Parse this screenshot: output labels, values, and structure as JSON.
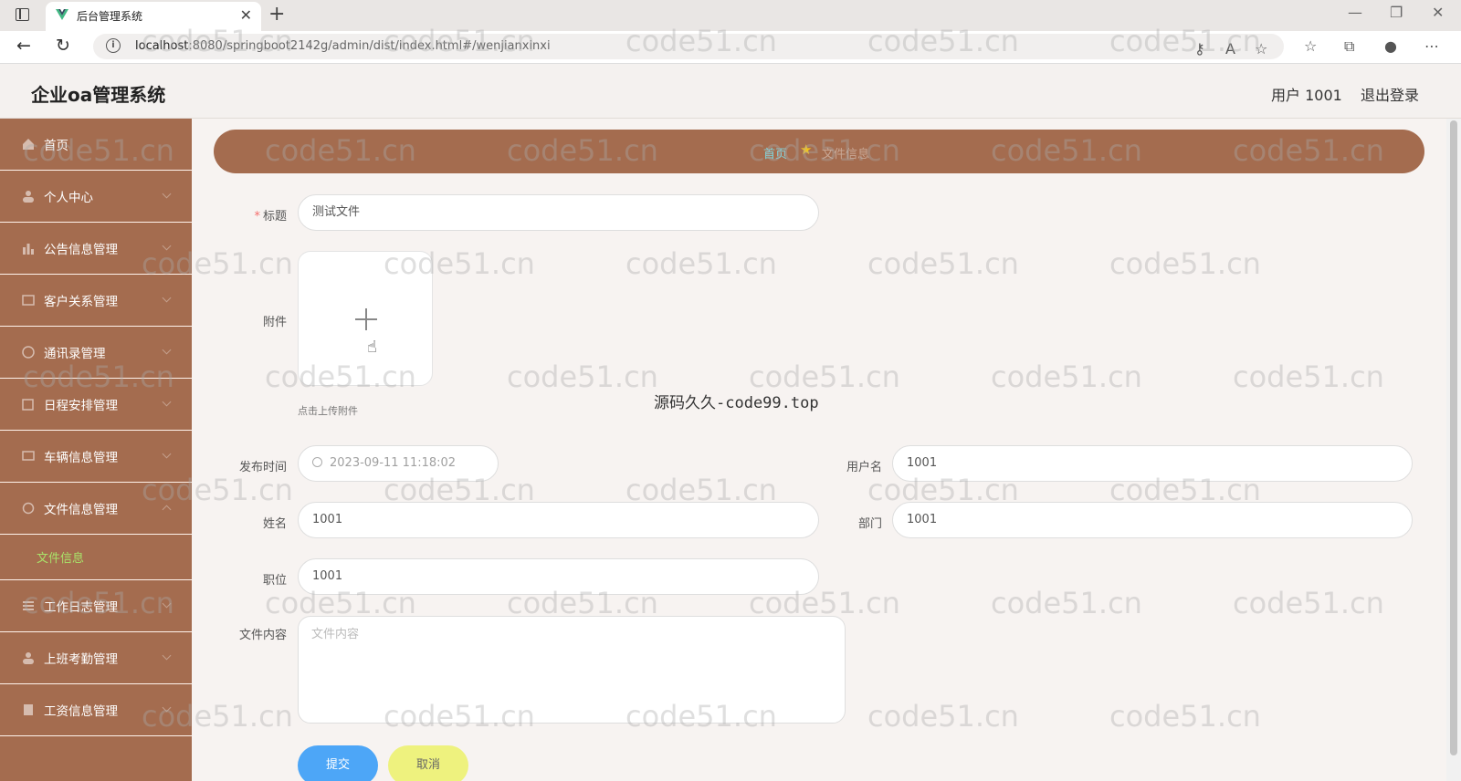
{
  "browser": {
    "tab_title": "后台管理系统",
    "url_host": "localhost",
    "url_rest": ":8080/springboot2142g/admin/dist/index.html#/wenjianxinxi"
  },
  "header": {
    "title": "企业oa管理系统",
    "user": "用户 1001",
    "logout": "退出登录"
  },
  "sidebar": {
    "items": [
      {
        "label": "首页",
        "icon": "home-icon"
      },
      {
        "label": "个人中心",
        "icon": "user-icon"
      },
      {
        "label": "公告信息管理",
        "icon": "chart-icon"
      },
      {
        "label": "客户关系管理",
        "icon": "image-icon"
      },
      {
        "label": "通讯录管理",
        "icon": "compass-icon"
      },
      {
        "label": "日程安排管理",
        "icon": "edit-icon"
      },
      {
        "label": "车辆信息管理",
        "icon": "message-icon"
      },
      {
        "label": "文件信息管理",
        "icon": "refresh-icon"
      },
      {
        "label": "工作日志管理",
        "icon": "menu-icon"
      },
      {
        "label": "上班考勤管理",
        "icon": "user-icon"
      },
      {
        "label": "工资信息管理",
        "icon": "doc-icon"
      }
    ],
    "submenu_active": "文件信息"
  },
  "breadcrumb": {
    "home": "首页",
    "current": "文件信息"
  },
  "form": {
    "title_label": "标题",
    "title_value": "测试文件",
    "attachment_label": "附件",
    "upload_tip": "点击上传附件",
    "publish_time_label": "发布时间",
    "publish_time_value": "2023-09-11 11:18:02",
    "username_label": "用户名",
    "username_value": "1001",
    "name_label": "姓名",
    "name_value": "1001",
    "dept_label": "部门",
    "dept_value": "1001",
    "position_label": "职位",
    "position_value": "1001",
    "content_label": "文件内容",
    "content_placeholder": "文件内容",
    "submit": "提交",
    "cancel": "取消"
  },
  "watermark": {
    "text": "code51.cn",
    "center_text": "源码久久-code99.top"
  }
}
